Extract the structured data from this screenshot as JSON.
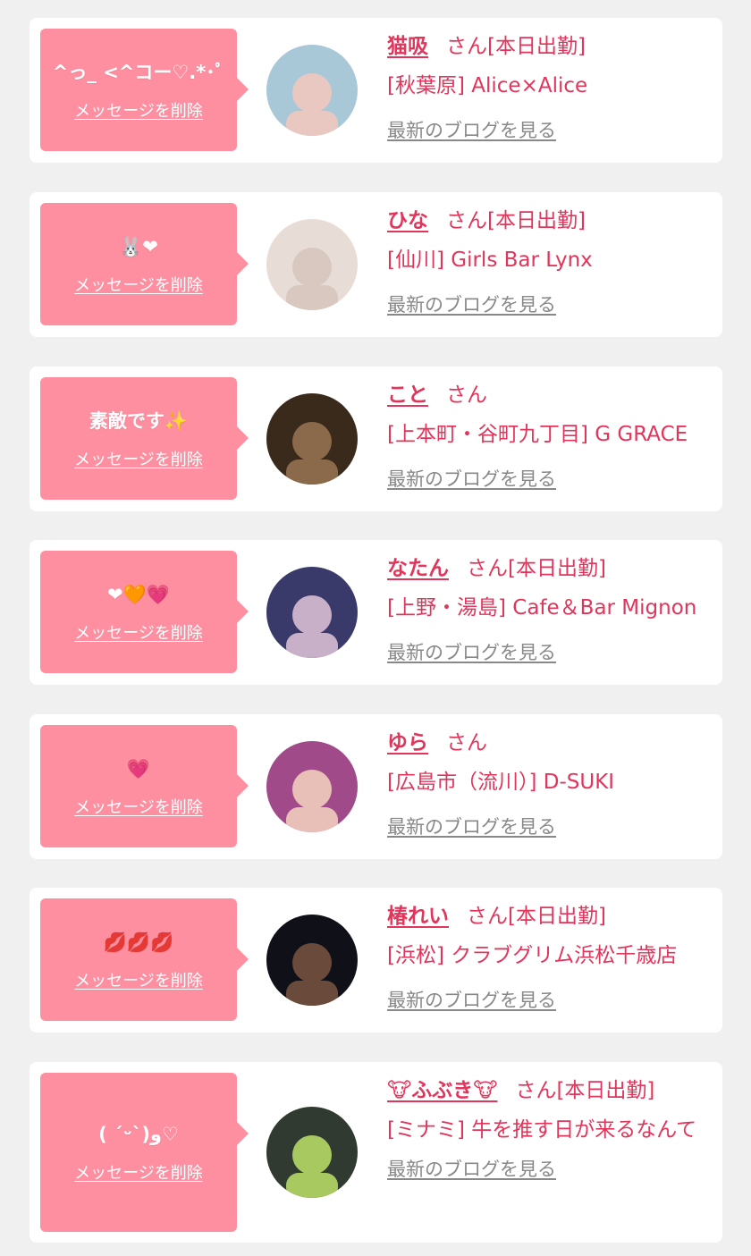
{
  "items": [
    {
      "message": "^っ_ <^コー♡.*･ﾟ",
      "delete_label": "メッセージを削除",
      "name": "猫吸",
      "honorific": "さん[本日出勤]",
      "shop": "[秋葉原] Alice×Alice",
      "blog_label": "最新のブログを見る",
      "avatar_colors": [
        "#a8c8d8",
        "#e8c8c0"
      ]
    },
    {
      "message": "🐰❤",
      "delete_label": "メッセージを削除",
      "name": "ひな",
      "honorific": "さん[本日出勤]",
      "shop": "[仙川] Girls Bar Lynx",
      "blog_label": "最新のブログを見る",
      "avatar_colors": [
        "#e8ddd6",
        "#d8c8c0"
      ]
    },
    {
      "message": "素敵です✨",
      "delete_label": "メッセージを削除",
      "name": "こと",
      "honorific": "さん",
      "shop": "[上本町・谷町九丁目] G GRACE",
      "blog_label": "最新のブログを見る",
      "avatar_colors": [
        "#3a2a1c",
        "#8a6a4a"
      ]
    },
    {
      "message": "❤🧡💗",
      "delete_label": "メッセージを削除",
      "name": "なたん",
      "honorific": "さん[本日出勤]",
      "shop": "[上野・湯島] Cafe＆Bar Mignon",
      "blog_label": "最新のブログを見る",
      "avatar_colors": [
        "#3a3a6a",
        "#c8b0c8"
      ]
    },
    {
      "message": "💗",
      "delete_label": "メッセージを削除",
      "name": "ゆら",
      "honorific": "さん",
      "shop": "[広島市（流川）] D-SUKI",
      "blog_label": "最新のブログを見る",
      "avatar_colors": [
        "#a04a8a",
        "#e8c0b8"
      ]
    },
    {
      "message": "💋💋💋",
      "delete_label": "メッセージを削除",
      "name": "椿れい",
      "honorific": "さん[本日出勤]",
      "shop": "[浜松] クラブグリム浜松千歳店",
      "blog_label": "最新のブログを見る",
      "avatar_colors": [
        "#101018",
        "#6a4a3a"
      ]
    },
    {
      "message": "( ˊᵕˋ)و♡",
      "delete_label": "メッセージを削除",
      "name": "🐮ふぶき🐮",
      "honorific": "さん[本日出勤]",
      "shop": "[ミナミ] 牛を推す日が来るなんて",
      "blog_label": "最新のブログを見る",
      "avatar_colors": [
        "#303a30",
        "#a8c860"
      ]
    }
  ],
  "colors": {
    "page_background": "#f0f0f0",
    "card_background": "#ffffff",
    "bubble": "#fe8fa0",
    "accent": "#e2355b",
    "link_gray": "#888888"
  }
}
